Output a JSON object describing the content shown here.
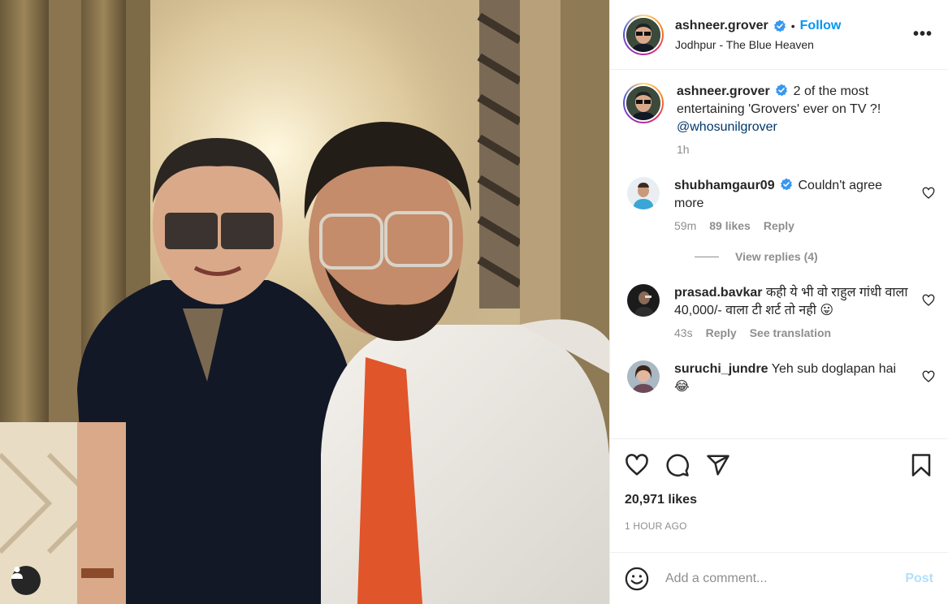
{
  "post": {
    "username": "ashneer.grover",
    "follow_label": "Follow",
    "separator": "•",
    "location": "Jodhpur - The Blue Heaven",
    "more_label": "•••"
  },
  "caption": {
    "username": "ashneer.grover",
    "text": "2 of the most entertaining 'Grovers' ever on TV ?!",
    "mention": "@whosunilgrover",
    "time": "1h"
  },
  "comments": [
    {
      "username": "shubhamgaur09",
      "verified": true,
      "text": "Couldn't agree more",
      "time": "59m",
      "likes": "89 likes",
      "reply": "Reply"
    },
    {
      "username": "prasad.bavkar",
      "verified": false,
      "text": "कही ये भी वो राहुल गांधी वाला 40,000/- वाला टी शर्ट तो नही 😛",
      "time": "43s",
      "reply": "Reply",
      "translate": "See translation"
    },
    {
      "username": "suruchi_jundre",
      "verified": false,
      "text": "Yeh sub doglapan hai 😂",
      "time": "",
      "reply": ""
    }
  ],
  "view_replies": "View replies (4)",
  "engagement": {
    "likes": "20,971 likes",
    "timestamp": "1 HOUR AGO"
  },
  "add_comment": {
    "placeholder": "Add a comment...",
    "post_label": "Post"
  },
  "colors": {
    "accent": "#0095f6",
    "verified": "#3897f0",
    "muted": "#8e8e8e",
    "post_disabled": "#b2dffc"
  },
  "icons": [
    "verified-badge-icon",
    "heart-icon",
    "comment-icon",
    "share-icon",
    "bookmark-icon",
    "emoji-icon",
    "user-tag-icon",
    "more-options-icon"
  ]
}
